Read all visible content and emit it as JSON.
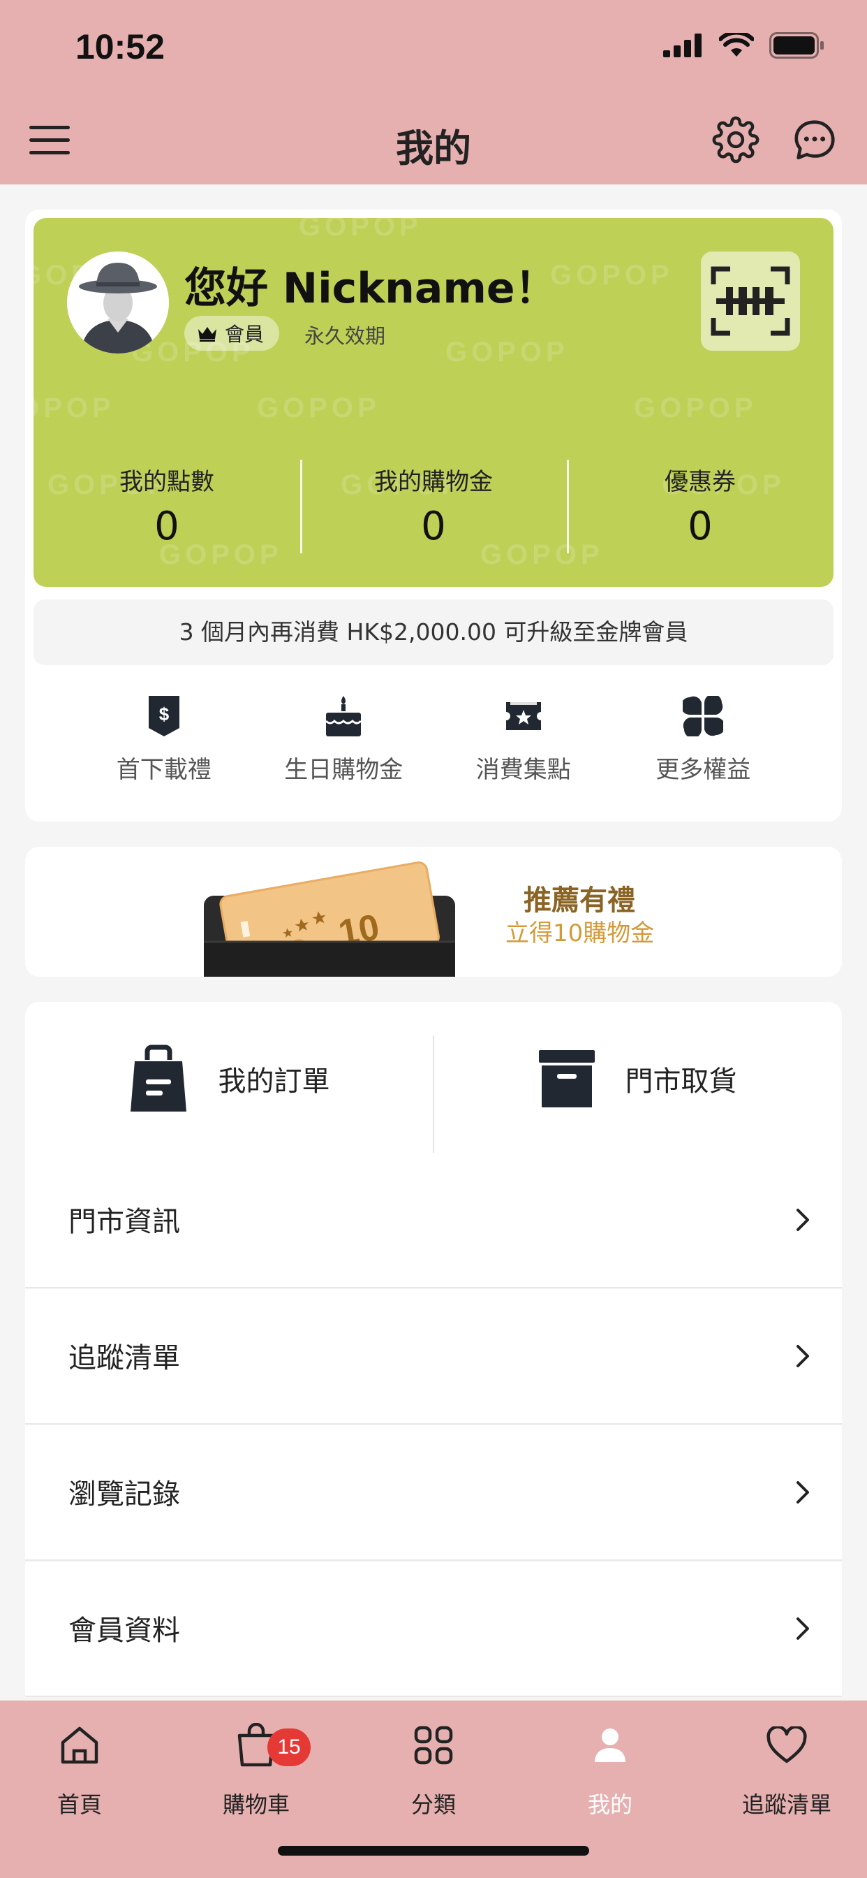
{
  "status_bar": {
    "time": "10:52"
  },
  "header": {
    "title": "我的"
  },
  "member": {
    "greeting": "您好 Nickname！",
    "tier": "會員",
    "validity": "永久效期",
    "watermark_text": "GOPOP",
    "stats": [
      {
        "label": "我的點數",
        "value": "0"
      },
      {
        "label": "我的購物金",
        "value": "0"
      },
      {
        "label": "優惠券",
        "value": "0"
      }
    ],
    "upgrade_text": "3 個月內再消費 HK$2,000.00 可升級至金牌會員",
    "benefits": [
      {
        "label": "首下載禮",
        "icon": "dollar-shield-icon"
      },
      {
        "label": "生日購物金",
        "icon": "cake-icon"
      },
      {
        "label": "消費集點",
        "icon": "ticket-star-icon"
      },
      {
        "label": "更多權益",
        "icon": "petals-icon"
      }
    ]
  },
  "referral": {
    "title": "推薦有禮",
    "subtitle": "立得10購物金",
    "ticket_value": "10"
  },
  "orders": {
    "my_orders": "我的訂單",
    "store_pickup": "門市取貨"
  },
  "menu": [
    {
      "label": "門市資訊"
    },
    {
      "label": "追蹤清單"
    },
    {
      "label": "瀏覽記錄"
    },
    {
      "label": "會員資料"
    }
  ],
  "tabs": [
    {
      "label": "首頁",
      "icon": "home-icon"
    },
    {
      "label": "購物車",
      "icon": "cart-icon",
      "badge": "15"
    },
    {
      "label": "分類",
      "icon": "category-icon"
    },
    {
      "label": "我的",
      "icon": "profile-icon",
      "active": true
    },
    {
      "label": "追蹤清單",
      "icon": "heart-icon"
    }
  ],
  "colors": {
    "header_bg": "#e6b0b0",
    "member_card": "#bed056",
    "referral_title": "#8a6424",
    "referral_sub": "#d49a3a",
    "badge": "#e53935"
  }
}
